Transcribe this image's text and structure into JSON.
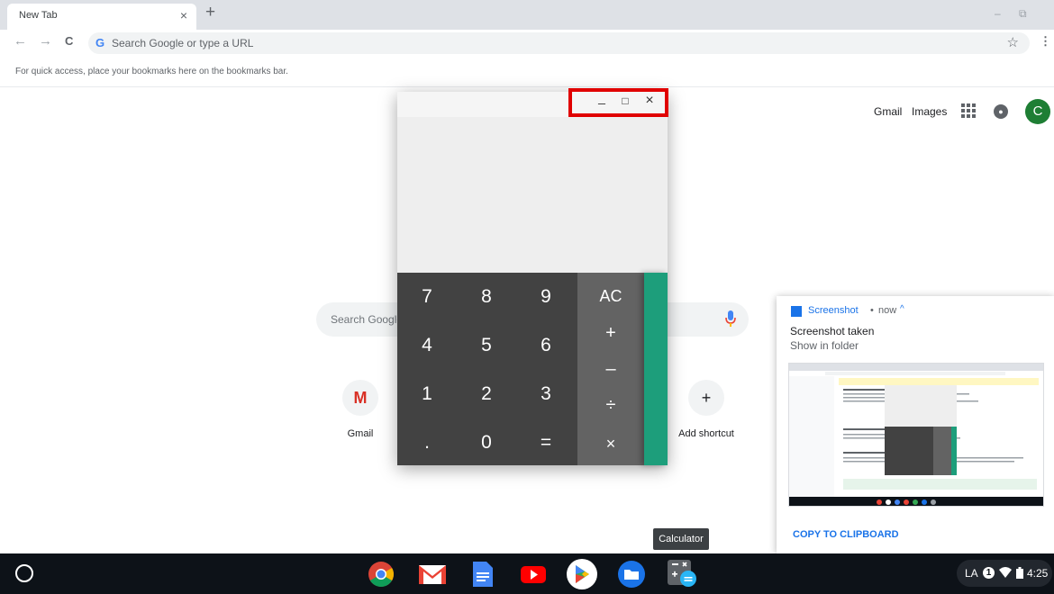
{
  "browser": {
    "tab_title": "New Tab",
    "tab_close": "×",
    "new_tab": "+",
    "window_min": "–",
    "window_restore": "⧉",
    "omnibox_placeholder": "Search Google or type a URL",
    "omnibox_g": "G",
    "back": "←",
    "forward": "→",
    "reload": "C",
    "bookmark_star": "☆",
    "menu": "⋮",
    "bookmarks_hint": "For quick access, place your bookmarks here on the bookmarks bar."
  },
  "ntp": {
    "links": [
      "Gmail",
      "Images"
    ],
    "avatar_letter": "C",
    "search_placeholder": "Search Google or type a URL",
    "shortcuts": [
      {
        "label": "Gmail",
        "glyph": "M",
        "icon": "gmail-icon"
      },
      {
        "label": "Add shortcut",
        "glyph": "+",
        "icon": "plus-icon"
      }
    ]
  },
  "calculator": {
    "window_controls": [
      "_",
      "□",
      "×"
    ],
    "digits": [
      "7",
      "8",
      "9",
      "4",
      "5",
      "6",
      "1",
      "2",
      "3",
      ".",
      "0",
      "="
    ],
    "operators": [
      "AC",
      "+",
      "–",
      "÷",
      "×"
    ],
    "accent_color": "#1d9e7b"
  },
  "notification": {
    "app": "Screenshot",
    "separator": "•",
    "time": "now",
    "caret": "^",
    "title": "Screenshot taken",
    "subtitle": "Show in folder",
    "action": "COPY TO CLIPBOARD"
  },
  "tooltip": "Calculator",
  "shelf": {
    "apps": [
      "chrome-icon",
      "gmail-icon",
      "docs-icon",
      "youtube-icon",
      "play-store-icon",
      "files-icon",
      "calculator-icon"
    ],
    "status_lang": "LA",
    "status_badge": "1",
    "time": "4:25"
  }
}
